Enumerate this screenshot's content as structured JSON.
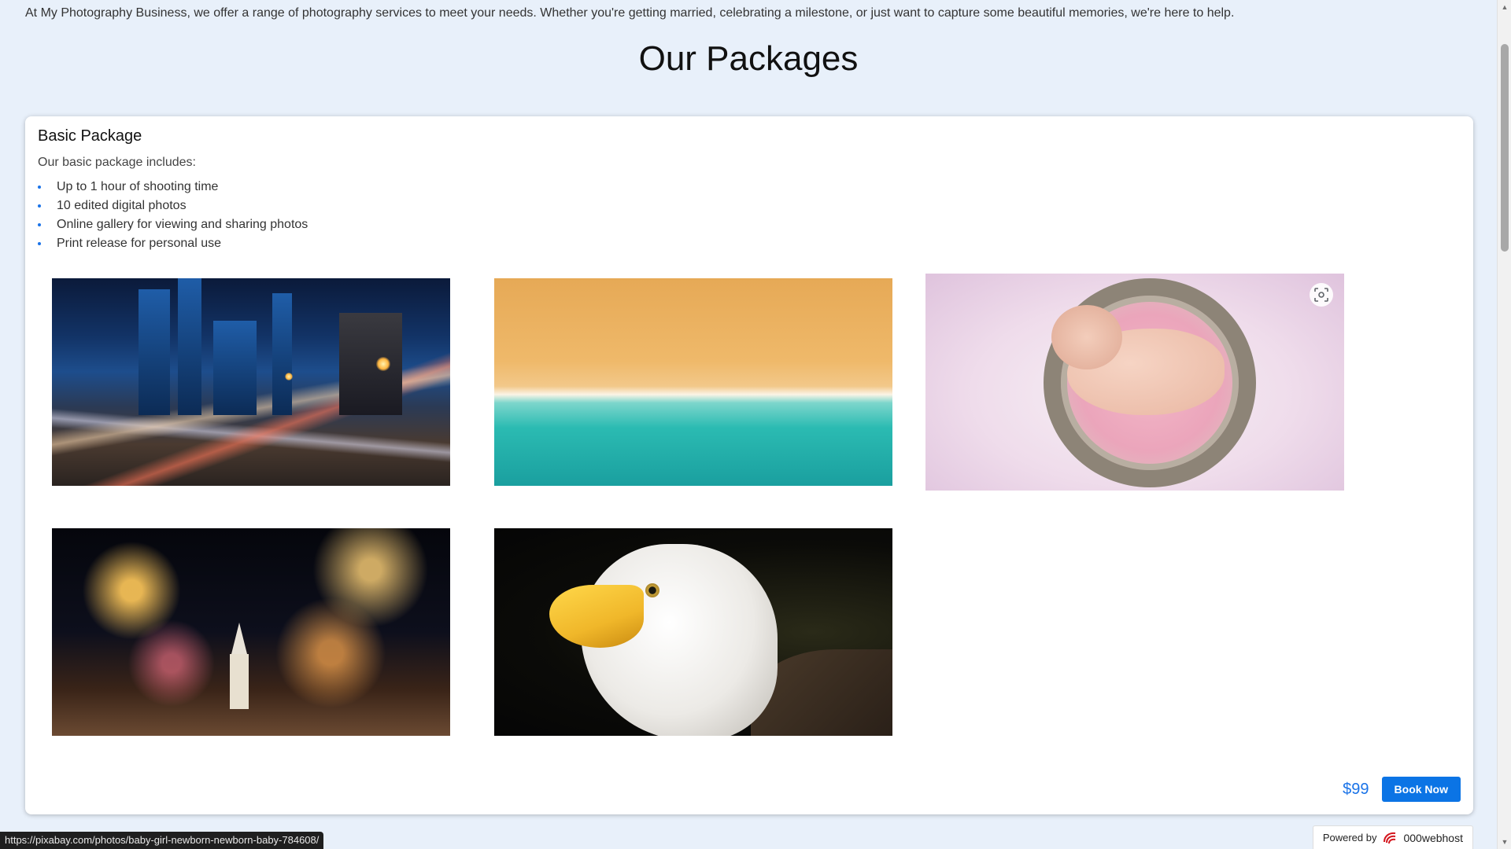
{
  "intro": {
    "text": "At My Photography Business, we offer a range of photography services to meet your needs. Whether you're getting married, celebrating a milestone, or just want to capture some beautiful memories, we're here to help."
  },
  "packages_section": {
    "title": "Our Packages"
  },
  "package": {
    "title": "Basic Package",
    "intro": "Our basic package includes:",
    "features": [
      "Up to 1 hour of shooting time",
      "10 edited digital photos",
      "Online gallery for viewing and sharing photos",
      "Print release for personal use"
    ],
    "gallery": [
      {
        "subject": "city-light-trails"
      },
      {
        "subject": "beach-aerial"
      },
      {
        "subject": "newborn-baby-nest"
      },
      {
        "subject": "christmas-street-lights"
      },
      {
        "subject": "bald-eagle"
      }
    ],
    "price": "$99",
    "book_label": "Book Now"
  },
  "status_bar": {
    "url": "https://pixabay.com/photos/baby-girl-newborn-newborn-baby-784608/"
  },
  "badge": {
    "powered_label": "Powered by",
    "brand": "000webhost"
  },
  "colors": {
    "page_bg": "#e8f0fa",
    "accent": "#1a73e8",
    "button": "#0b74e5"
  },
  "icons": {
    "lens": "visual-search-icon",
    "brand_logo": "000webhost-logo-icon"
  }
}
